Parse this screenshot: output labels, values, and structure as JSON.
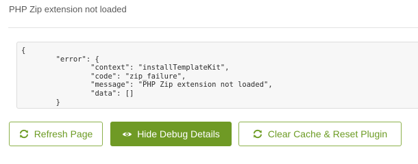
{
  "error": {
    "title": "PHP Zip extension not loaded"
  },
  "debug": {
    "details": "{\n\t\"error\": {\n\t\t\"context\": \"installTemplateKit\",\n\t\t\"code\": \"zip_failure\",\n\t\t\"message\": \"PHP Zip extension not loaded\",\n\t\t\"data\": []\n\t}"
  },
  "actions": {
    "refresh": {
      "label": "Refresh Page",
      "icon": "refresh-icon"
    },
    "hide_debug": {
      "label": "Hide Debug Details",
      "icon": "eye-icon"
    },
    "clear_cache": {
      "label": "Clear Cache & Reset Plugin",
      "icon": "refresh-icon"
    }
  },
  "colors": {
    "accent": "#6f9a25",
    "accent_text": "#6c9b23",
    "outline_border": "#8bb04a"
  }
}
